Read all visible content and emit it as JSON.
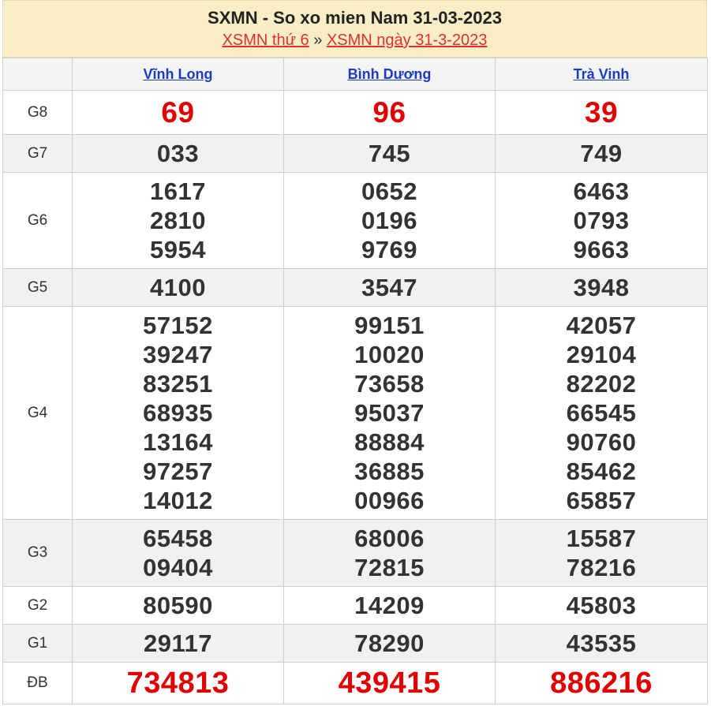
{
  "header": {
    "title": "SXMN - So xo mien Nam 31-03-2023",
    "link1": "XSMN thứ 6",
    "separator": "»",
    "link2": "XSMN ngày 31-3-2023"
  },
  "provinces": [
    "Vĩnh Long",
    "Bình Dương",
    "Trà Vinh"
  ],
  "prizes": {
    "g8": {
      "label": "G8",
      "values": [
        [
          "69"
        ],
        [
          "96"
        ],
        [
          "39"
        ]
      ]
    },
    "g7": {
      "label": "G7",
      "values": [
        [
          "033"
        ],
        [
          "745"
        ],
        [
          "749"
        ]
      ]
    },
    "g6": {
      "label": "G6",
      "values": [
        [
          "1617",
          "2810",
          "5954"
        ],
        [
          "0652",
          "0196",
          "9769"
        ],
        [
          "6463",
          "0793",
          "9663"
        ]
      ]
    },
    "g5": {
      "label": "G5",
      "values": [
        [
          "4100"
        ],
        [
          "3547"
        ],
        [
          "3948"
        ]
      ]
    },
    "g4": {
      "label": "G4",
      "values": [
        [
          "57152",
          "39247",
          "83251",
          "68935",
          "13164",
          "97257",
          "14012"
        ],
        [
          "99151",
          "10020",
          "73658",
          "95037",
          "88884",
          "36885",
          "00966"
        ],
        [
          "42057",
          "29104",
          "82202",
          "66545",
          "90760",
          "85462",
          "65857"
        ]
      ]
    },
    "g3": {
      "label": "G3",
      "values": [
        [
          "65458",
          "09404"
        ],
        [
          "68006",
          "72815"
        ],
        [
          "15587",
          "78216"
        ]
      ]
    },
    "g2": {
      "label": "G2",
      "values": [
        [
          "80590"
        ],
        [
          "14209"
        ],
        [
          "45803"
        ]
      ]
    },
    "g1": {
      "label": "G1",
      "values": [
        [
          "29117"
        ],
        [
          "78290"
        ],
        [
          "43535"
        ]
      ]
    },
    "db": {
      "label": "ĐB",
      "values": [
        [
          "734813"
        ],
        [
          "439415"
        ],
        [
          "886216"
        ]
      ]
    }
  },
  "colors": {
    "special_red": "#e00000",
    "link_red": "#e03030",
    "link_blue": "#1a3cbf",
    "header_bg": "#f9edc6"
  }
}
